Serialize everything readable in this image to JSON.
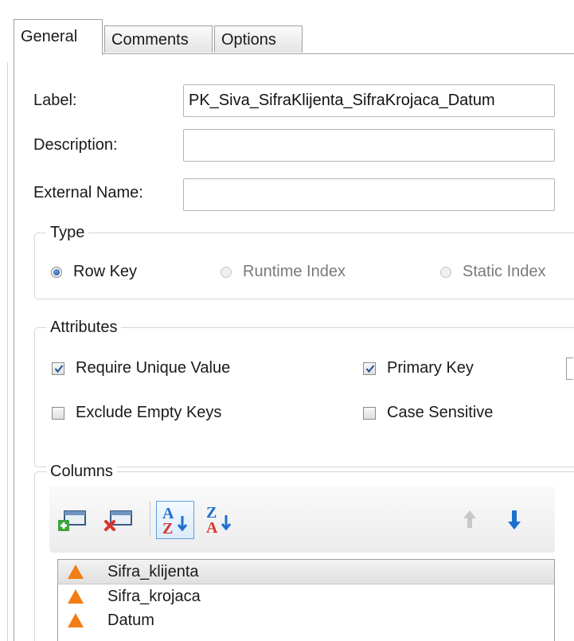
{
  "tabs": [
    {
      "label": "General",
      "active": true
    },
    {
      "label": "Comments",
      "active": false
    },
    {
      "label": "Options",
      "active": false
    }
  ],
  "form": {
    "label": {
      "caption": "Label:",
      "value": "PK_Siva_SifraKlijenta_SifraKrojaca_Datum"
    },
    "description": {
      "caption": "Description:",
      "value": ""
    },
    "external_name": {
      "caption": "External Name:",
      "value": ""
    }
  },
  "type_group": {
    "title": "Type",
    "options": [
      {
        "label": "Row Key",
        "checked": true,
        "enabled": true
      },
      {
        "label": "Runtime Index",
        "checked": false,
        "enabled": false
      },
      {
        "label": "Static Index",
        "checked": false,
        "enabled": false
      }
    ]
  },
  "attributes_group": {
    "title": "Attributes",
    "checkboxes": [
      {
        "label": "Require Unique Value",
        "checked": true
      },
      {
        "label": "Primary Key",
        "checked": true
      },
      {
        "label": "Exclude Empty Keys",
        "checked": false
      },
      {
        "label": "Case Sensitive",
        "checked": false
      }
    ]
  },
  "columns_group": {
    "title": "Columns",
    "toolbar": [
      {
        "icon": "add-column-icon"
      },
      {
        "icon": "remove-column-icon"
      },
      {
        "icon": "sort-ascending-icon",
        "pressed": true
      },
      {
        "icon": "sort-descending-icon"
      },
      {
        "icon": "move-up-icon",
        "enabled": false
      },
      {
        "icon": "move-down-icon",
        "enabled": true
      }
    ],
    "items": [
      {
        "name": "Sifra_klijenta",
        "selected": true
      },
      {
        "name": "Sifra_krojaca",
        "selected": false
      },
      {
        "name": "Datum",
        "selected": false
      }
    ]
  },
  "colors": {
    "accent_blue": "#1d6fd1",
    "key_orange": "#f07e14",
    "add_green": "#3ba43b",
    "remove_red": "#d9342b"
  }
}
